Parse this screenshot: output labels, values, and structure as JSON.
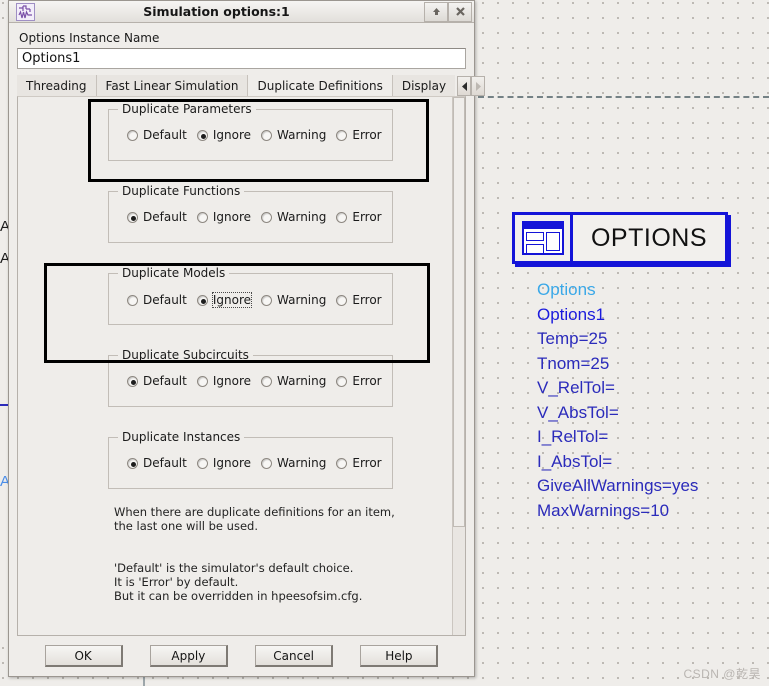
{
  "window": {
    "title": "Simulation options:1",
    "icon": "schematic-icon",
    "shade_button": "⬆",
    "close_button": "✕"
  },
  "form": {
    "instance_label": "Options Instance Name",
    "instance_value": "Options1",
    "instance_placeholder": "Options1"
  },
  "tabs": [
    {
      "label": "Threading",
      "active": false
    },
    {
      "label": "Fast Linear Simulation",
      "active": false
    },
    {
      "label": "Duplicate Definitions",
      "active": true
    },
    {
      "label": "Display",
      "active": false
    }
  ],
  "tab_nav": {
    "left": "◀",
    "right": "▶"
  },
  "options": [
    "Default",
    "Ignore",
    "Warning",
    "Error"
  ],
  "groups": [
    {
      "legend": "Duplicate Parameters",
      "selected": "Ignore",
      "focused": false,
      "highlighted": true
    },
    {
      "legend": "Duplicate Functions",
      "selected": "Default",
      "focused": false,
      "highlighted": false
    },
    {
      "legend": "Duplicate Models",
      "selected": "Ignore",
      "focused": true,
      "highlighted": true
    },
    {
      "legend": "Duplicate Subcircuits",
      "selected": "Default",
      "focused": false,
      "highlighted": false
    },
    {
      "legend": "Duplicate Instances",
      "selected": "Default",
      "focused": false,
      "highlighted": false
    }
  ],
  "help_text": "When there are duplicate definitions for an item,\nthe last one will be used.\n\n\n'Default' is the simulator's default choice.\nIt is 'Error' by default.\nBut it can be overridden in hpeesofsim.cfg.",
  "buttons": [
    {
      "label": "OK"
    },
    {
      "label": "Apply"
    },
    {
      "label": "Cancel"
    },
    {
      "label": "Help"
    }
  ],
  "canvas": {
    "component_label": "OPTIONS",
    "component_icon": "options-symbol-icon",
    "params": [
      {
        "text": "Options",
        "style": "p0"
      },
      {
        "text": "Options1",
        "style": "p1"
      },
      {
        "text": "Temp=25",
        "style": ""
      },
      {
        "text": "Tnom=25",
        "style": ""
      },
      {
        "text": "V_RelTol=",
        "style": ""
      },
      {
        "text": "V_AbsTol=",
        "style": ""
      },
      {
        "text": "I_RelTol=",
        "style": ""
      },
      {
        "text": "I_AbsTol=",
        "style": ""
      },
      {
        "text": "GiveAllWarnings=yes",
        "style": ""
      },
      {
        "text": "MaxWarnings=10",
        "style": ""
      }
    ],
    "edge_fragments": [
      "A",
      "A",
      "AD"
    ],
    "watermark": "CSDN @乾昊",
    "colors": {
      "symbol_blue": "#1414d8",
      "param_blue": "#2b2bbb",
      "param_cyan": "#3aa8e8",
      "grid_dot": "#b9b5b0",
      "background": "#efedea"
    }
  }
}
